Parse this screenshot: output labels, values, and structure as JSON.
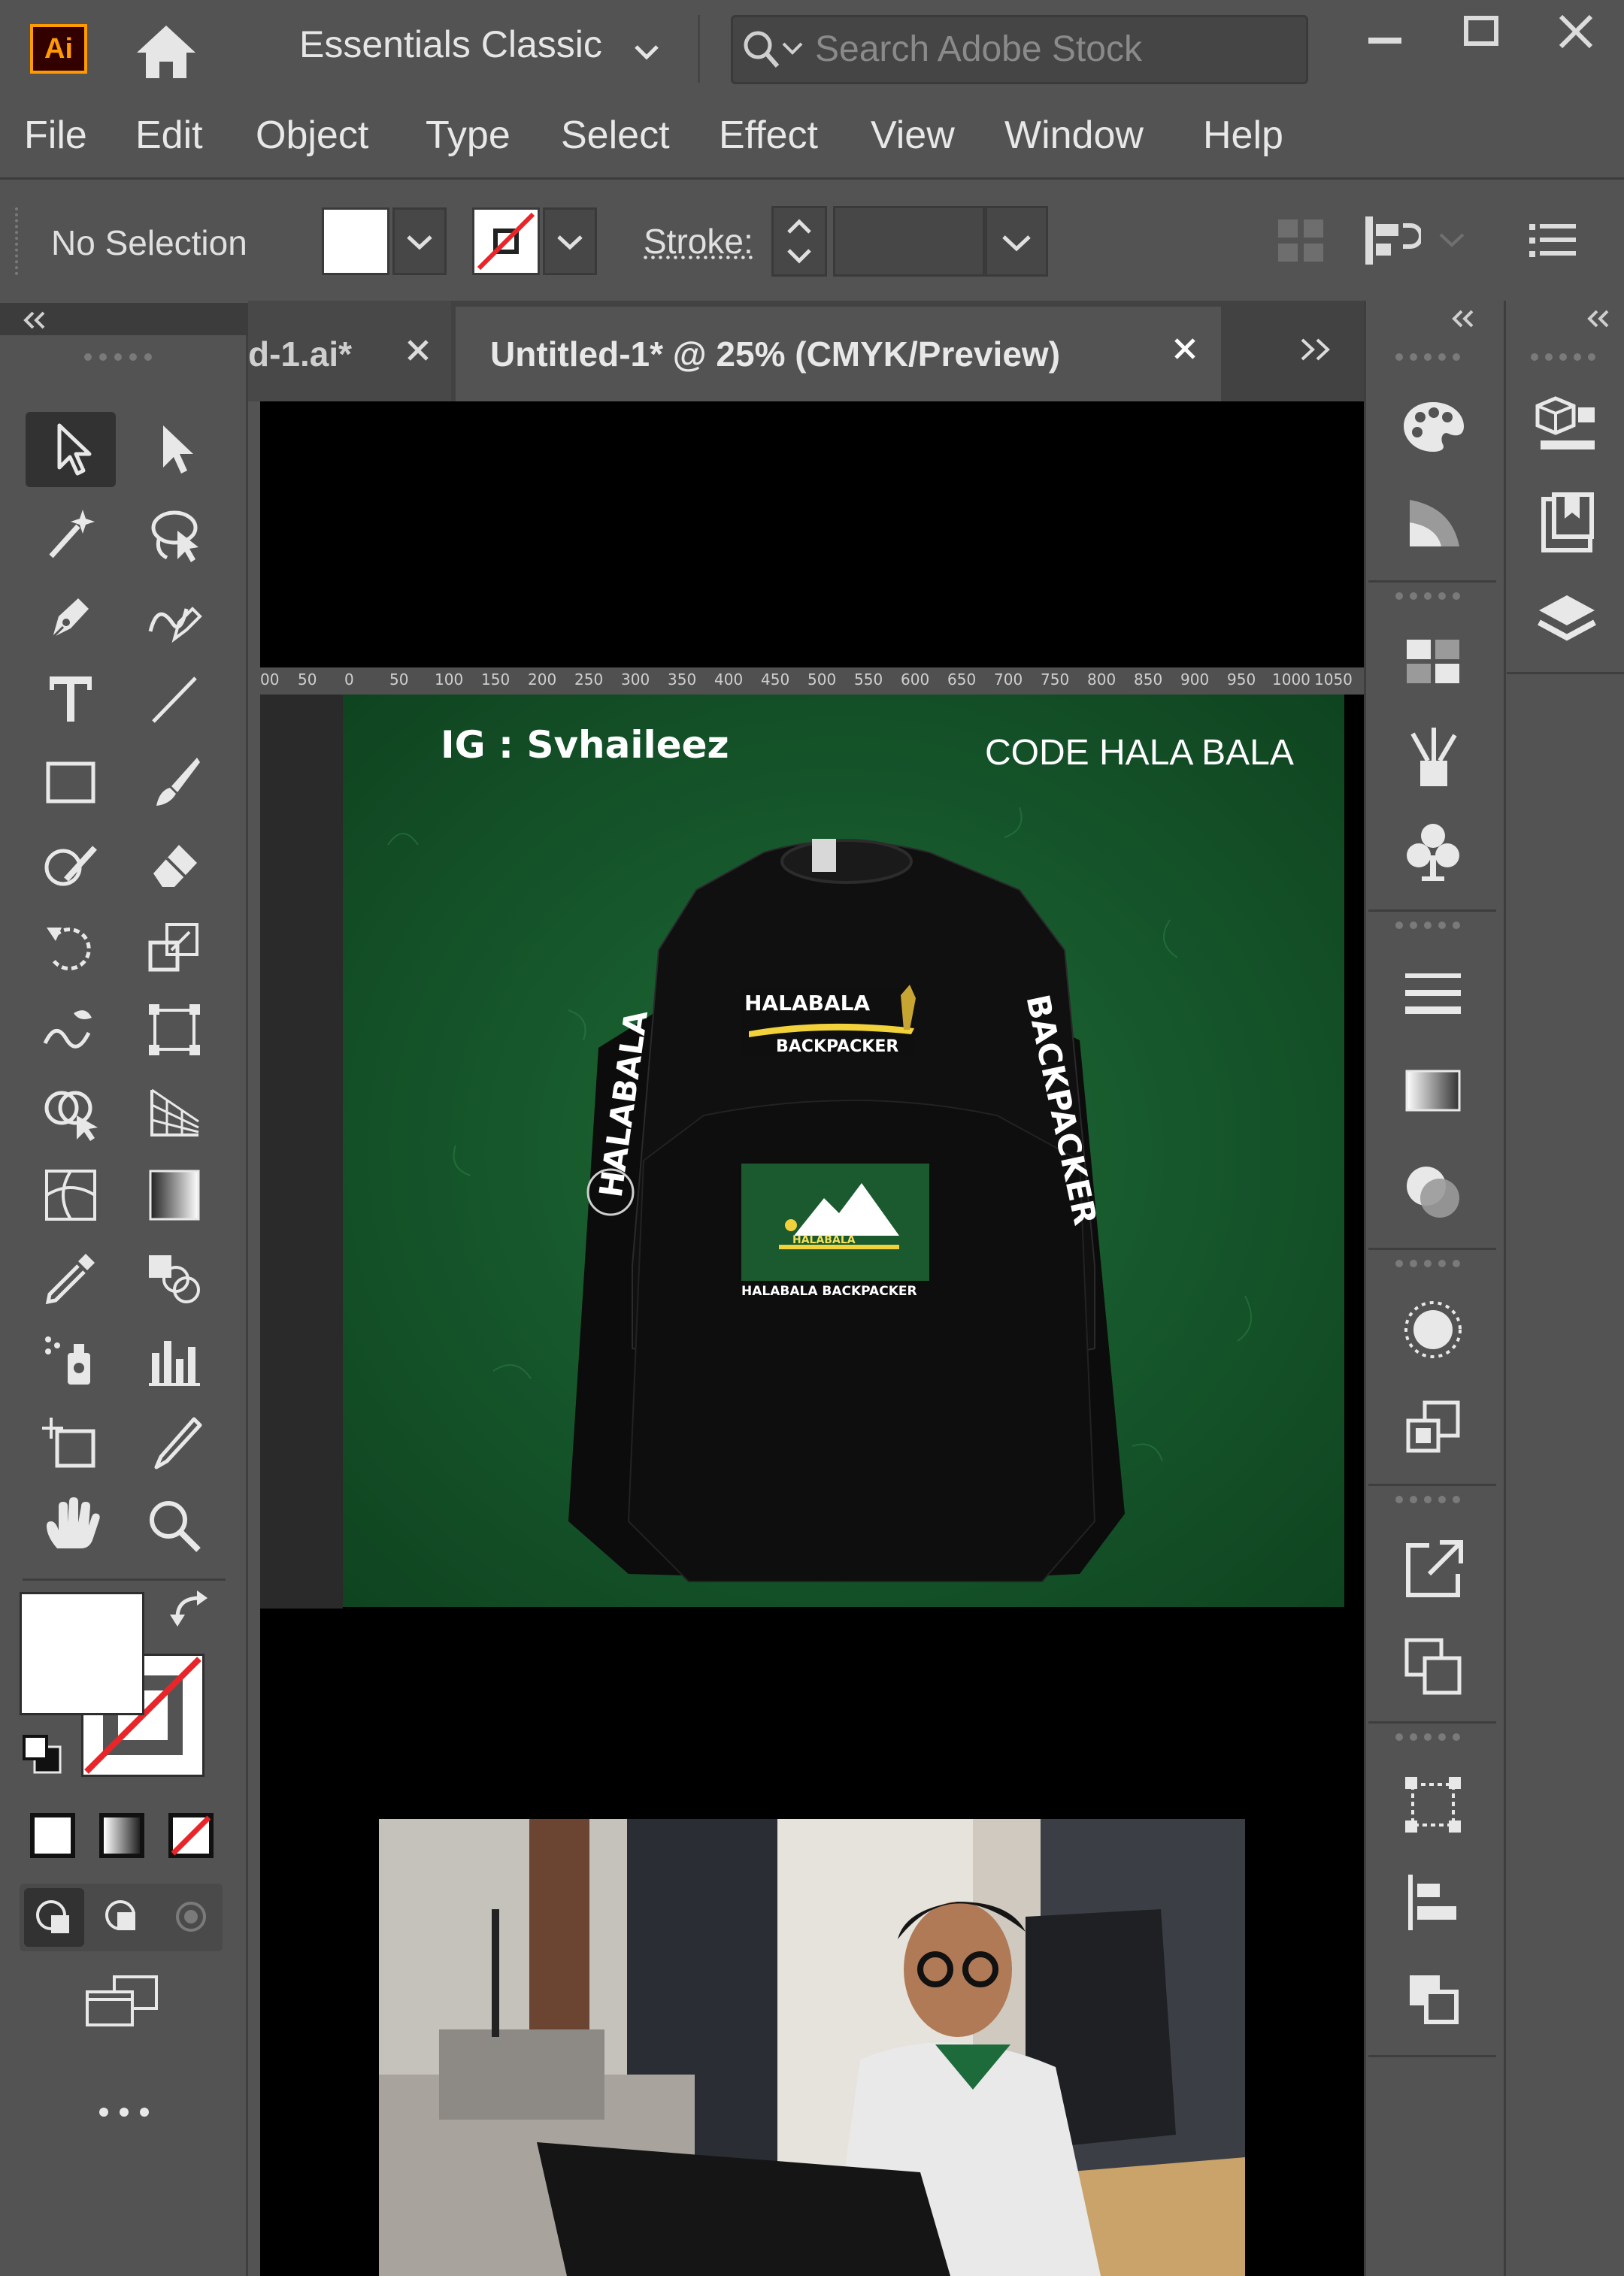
{
  "app": {
    "logo": "Ai",
    "workspace": "Essentials Classic",
    "search_placeholder": "Search Adobe Stock"
  },
  "window_controls": [
    "minimize-icon",
    "maximize-icon",
    "close-icon"
  ],
  "menu": [
    "File",
    "Edit",
    "Object",
    "Type",
    "Select",
    "Effect",
    "View",
    "Window",
    "Help"
  ],
  "control_bar": {
    "selection": "No Selection",
    "stroke_label": "Stroke:"
  },
  "tabs": [
    {
      "label": "d-1.ai*",
      "active": false
    },
    {
      "label": "Untitled-1* @ 25% (CMYK/Preview)",
      "active": true
    }
  ],
  "ruler": [
    "00",
    "50",
    "0",
    "50",
    "100",
    "150",
    "200",
    "250",
    "300",
    "350",
    "400",
    "450",
    "500",
    "550",
    "600",
    "650",
    "700",
    "750",
    "800",
    "850",
    "900",
    "950",
    "1000",
    "1050"
  ],
  "artboard": {
    "ig_handle": "IG : Svhaileez",
    "code": "CODE  HALA BALA",
    "sleeve_left": "HALABALA",
    "sleeve_right": "BACKPACKER",
    "front_logo_title": "HALABALA",
    "front_logo_sub": "BACKPACKER",
    "back_mini_logo": "HALABALA",
    "back_caption": "HALABALA BACKPACKER",
    "background_color": "#15502a",
    "shirt_color": "#0d0d0d"
  },
  "colors": {
    "ui_bg": "#535353",
    "ui_dark": "#3c3c3c",
    "logo_orange": "#ff9a00",
    "none_red": "#e8262a"
  }
}
